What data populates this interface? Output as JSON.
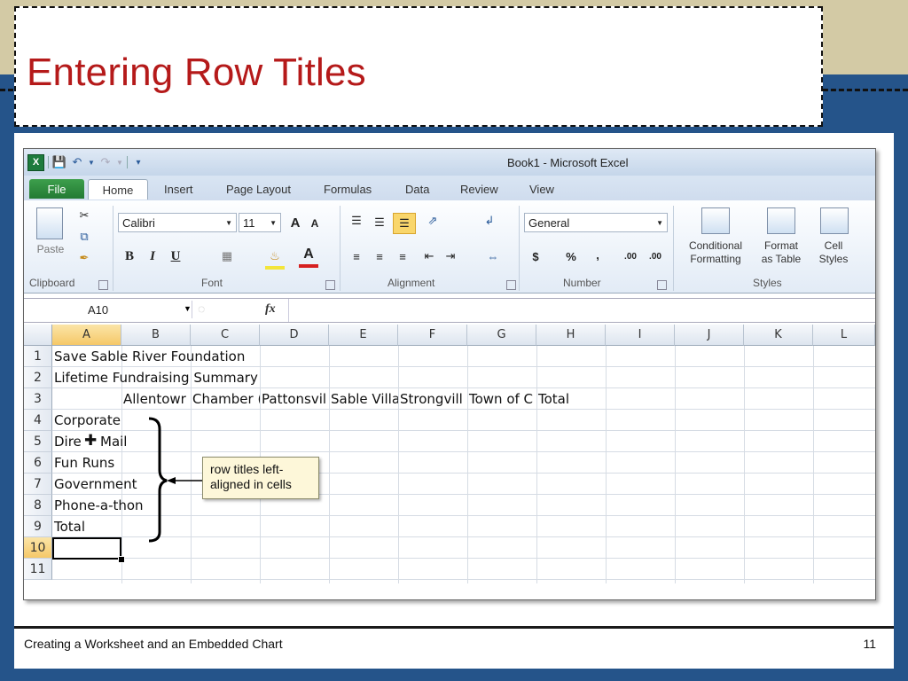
{
  "slide": {
    "title": "Entering Row Titles",
    "footer_left": "Creating a Worksheet and an Embedded Chart",
    "page_number": "11"
  },
  "excel": {
    "window_title": "Book1 - Microsoft Excel",
    "tabs": [
      "File",
      "Home",
      "Insert",
      "Page Layout",
      "Formulas",
      "Data",
      "Review",
      "View"
    ],
    "ribbon": {
      "clipboard": {
        "label": "Clipboard",
        "paste": "Paste"
      },
      "font": {
        "label": "Font",
        "name": "Calibri",
        "size": "11",
        "bold": "B",
        "italic": "I",
        "underline": "U",
        "grow": "A",
        "shrink": "A",
        "font_color": "A"
      },
      "alignment": {
        "label": "Alignment"
      },
      "number": {
        "label": "Number",
        "format": "General",
        "currency": "$",
        "percent": "%",
        "comma": ",",
        "inc_decimal": ".00",
        "dec_decimal": ".00"
      },
      "styles": {
        "label": "Styles",
        "conditional_1": "Conditional",
        "conditional_2": "Formatting",
        "format_table_1": "Format",
        "format_table_2": "as Table",
        "cell_styles_1": "Cell",
        "cell_styles_2": "Styles"
      }
    },
    "name_box": "A10",
    "fx": "fx",
    "columns": [
      "A",
      "B",
      "C",
      "D",
      "E",
      "F",
      "G",
      "H",
      "I",
      "J",
      "K",
      "L"
    ],
    "rows": [
      "1",
      "2",
      "3",
      "4",
      "5",
      "6",
      "7",
      "8",
      "9",
      "10",
      "11"
    ],
    "cells": {
      "r1": "Save Sable River Foundation",
      "r2": "Lifetime Fundraising Summary",
      "r3": [
        "Allentowr",
        "Chamber (",
        "Pattonsvil",
        "Sable Villa",
        "Strongvill",
        "Town of C",
        "Total"
      ],
      "r4": "Corporate",
      "r5a": "Dire",
      "r5b": "Mail",
      "r6": "Fun Runs",
      "r7": "Government",
      "r8": "Phone-a-thon",
      "r9": "Total"
    },
    "callout": "row titles left-aligned in cells",
    "colors": {
      "accent": "#b51a1a",
      "file_tab": "#237a33",
      "selection": "#f5c868"
    }
  }
}
